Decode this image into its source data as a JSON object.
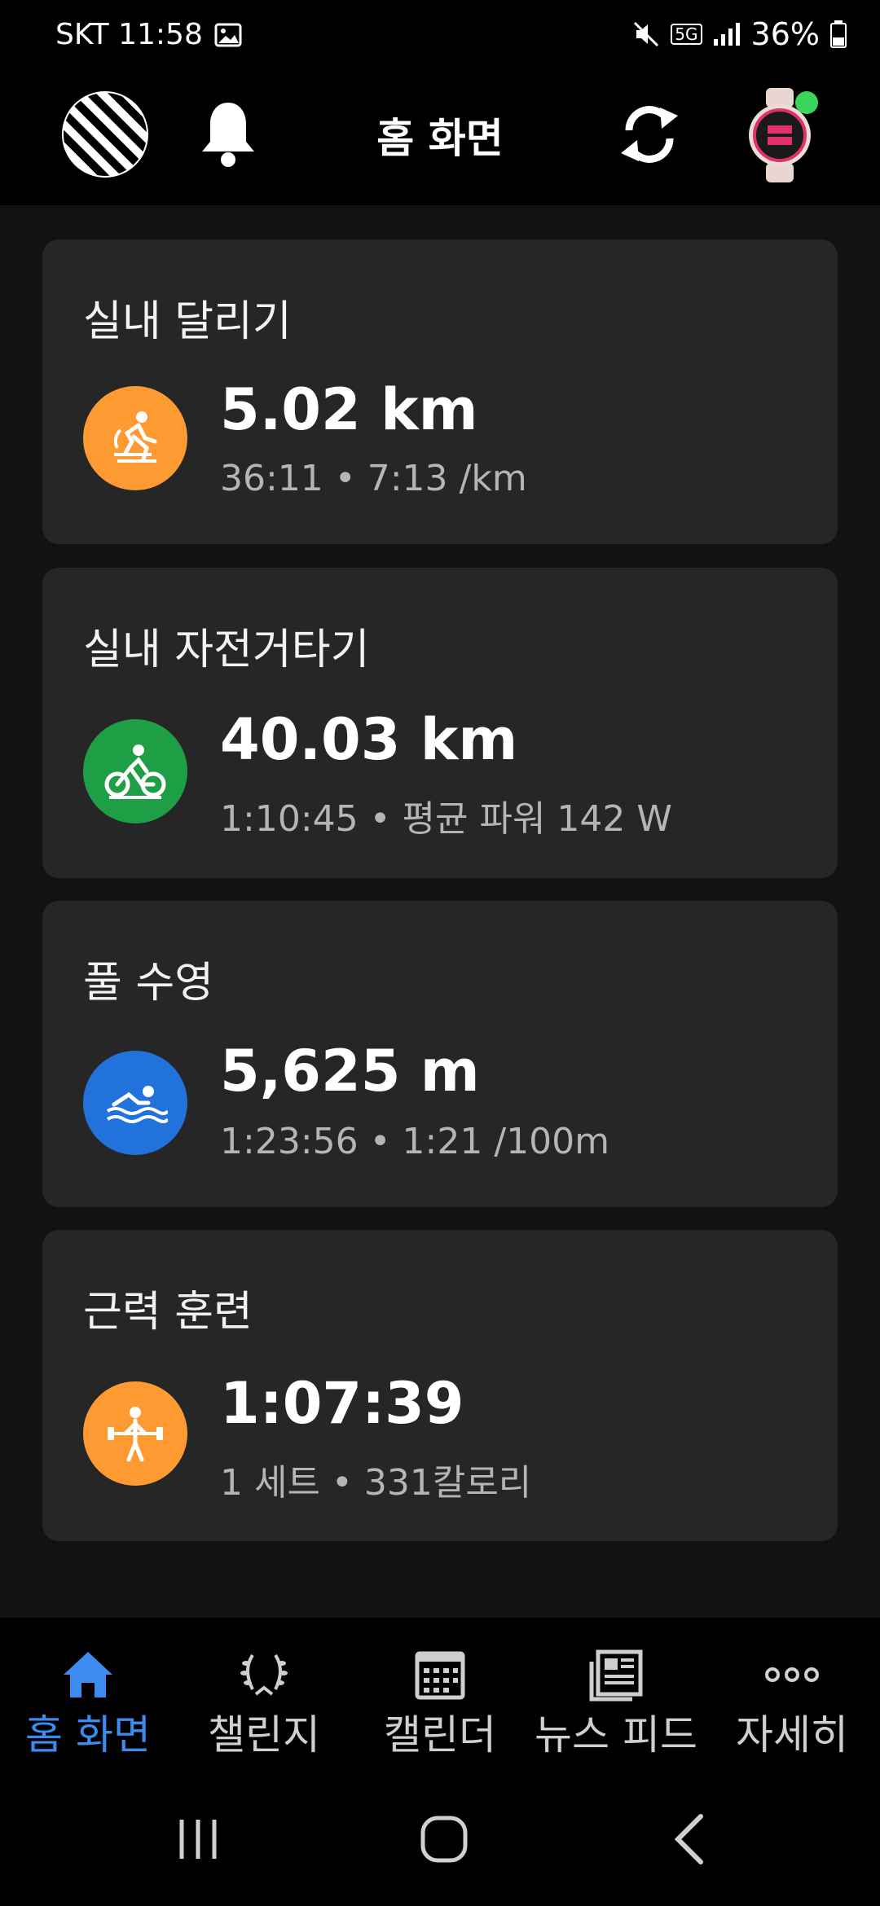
{
  "status_bar": {
    "carrier_time": "SKT 11:58",
    "battery": "36%",
    "network": "5G"
  },
  "header": {
    "title": "홈 화면"
  },
  "cards": [
    {
      "title": "실내 달리기",
      "value": "5.02 km",
      "sub": "36:11 • 7:13 /km",
      "icon": "indoor-running-icon",
      "color": "#fd9a32"
    },
    {
      "title": "실내 자전거타기",
      "value": "40.03 km",
      "sub": "1:10:45 • 평균 파워 142 W",
      "icon": "indoor-cycling-icon",
      "color": "#1e9e45"
    },
    {
      "title": "풀 수영",
      "value": "5,625 m",
      "sub": "1:23:56 • 1:21 /100m",
      "icon": "pool-swim-icon",
      "color": "#2272dc"
    },
    {
      "title": "근력 훈련",
      "value": "1:07:39",
      "sub": "1 세트 • 331칼로리",
      "icon": "strength-training-icon",
      "color": "#fd9a32"
    }
  ],
  "bottom_nav": [
    {
      "label": "홈 화면",
      "icon": "home-icon",
      "active": true
    },
    {
      "label": "챌린지",
      "icon": "laurel-icon"
    },
    {
      "label": "캘린더",
      "icon": "calendar-icon"
    },
    {
      "label": "뉴스 피드",
      "icon": "newsfeed-icon"
    },
    {
      "label": "자세히",
      "icon": "more-icon"
    }
  ],
  "colors": {
    "accent": "#3d8bf0",
    "background": "#121212",
    "card": "#262626",
    "online_dot": "#3ad65c"
  }
}
